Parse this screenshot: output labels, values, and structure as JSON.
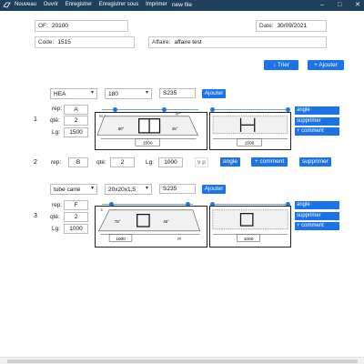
{
  "app": {
    "title": "new file",
    "menu": [
      "Nouveau",
      "Ouvrir",
      "Enregistrer",
      "Enregistrer sous",
      "Imprimer"
    ],
    "window_buttons": [
      "–",
      "□",
      "✕"
    ]
  },
  "header": {
    "of_label": "OF:",
    "of_value": "20100",
    "date_label": "Date:",
    "date_value": "30/09/2021",
    "code_label": "Code:",
    "code_value": "1515",
    "affaire_label": "Affaire:",
    "affaire_value": "affaire test",
    "trier_label": "↓ Trier",
    "ajouter_label": "+ Ajouter"
  },
  "common": {
    "rep_label": "rep:",
    "qte_label": "qté:",
    "lg_label": "Lg:",
    "ajouter_btn": "Ajouter",
    "angle_btn": "angle",
    "supprimer_btn": "supprimer",
    "comment_btn": "+ comment"
  },
  "items": [
    {
      "num": "1",
      "profile": "HEA",
      "size": "180",
      "material": "S235",
      "rep": "A",
      "qte": "2",
      "lg": "1500",
      "dim_left": "1500",
      "dim_right": "1500",
      "angle_a": "60°",
      "angle_b": "45°",
      "dim_top": "66.7",
      "dim_top2": "47°"
    },
    {
      "num": "2",
      "rep": "B",
      "qte": "2",
      "lg": "1000",
      "vp": "v p"
    },
    {
      "num": "3",
      "profile": "tube carré",
      "size": "20x20x1,5",
      "material": "S235",
      "rep": "F",
      "qte": "2",
      "lg": "1000",
      "dim_left": "1000",
      "dim_right": "1000",
      "angle_a": "75°",
      "angle_b": "45°",
      "dim_top": "5",
      "dim_side": "20"
    }
  ]
}
